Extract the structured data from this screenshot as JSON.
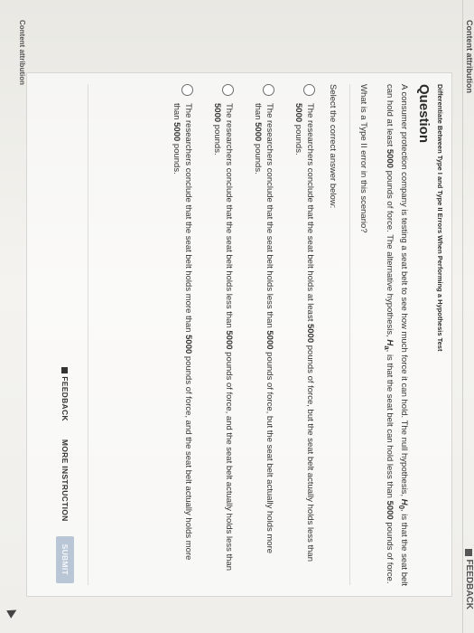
{
  "page": {
    "attribution_top": "Content attribution",
    "feedback_top": "FEEDBACK",
    "attribution_bottom": "Content attribution"
  },
  "question": {
    "breadcrumb": "Differentiate Between Type I and Type II Errors When Performing a Hypothesis Test",
    "heading": "Question",
    "text_part1": "A consumer protection company is testing a seat belt to see how much force it can hold. The null hypothesis, ",
    "h0": "H",
    "h0_sub": "0",
    "text_part2": ", is that the seat belt can hold at least ",
    "num1": "5000",
    "text_part3": " pounds of force. The alternative hypothesis, ",
    "ha": "H",
    "ha_sub": "a",
    "text_part4": ", is that the seat belt can hold less than ",
    "num2": "5000",
    "text_part5": " pounds of force.",
    "prompt": "What is a Type II error in this scenario?",
    "select_label": "Select the correct answer below:"
  },
  "answers": [
    {
      "pre": "The researchers conclude that the seat belt holds at least ",
      "n1": "5000",
      "mid": " pounds of force, but the seat belt actually holds less than ",
      "n2": "5000",
      "post": " pounds."
    },
    {
      "pre": "The researchers conclude that the seat belt holds less than ",
      "n1": "5000",
      "mid": " pounds of force, but the seat belt actually holds more than ",
      "n2": "5000",
      "post": " pounds."
    },
    {
      "pre": "The researchers conclude that the seat belt holds less than ",
      "n1": "5000",
      "mid": " pounds of force, and the seat belt actually holds less than ",
      "n2": "5000",
      "post": " pounds."
    },
    {
      "pre": "The researchers conclude that the seat belt holds more than ",
      "n1": "5000",
      "mid": " pounds of force, and the seat belt actually holds more than ",
      "n2": "5000",
      "post": " pounds."
    }
  ],
  "buttons": {
    "feedback": "FEEDBACK",
    "more_instruction": "MORE INSTRUCTION",
    "submit": "SUBMIT"
  },
  "icons": {
    "feedback_top": "flag-icon",
    "feedback_button": "flag-icon",
    "cursor": "mouse-cursor-icon"
  },
  "colors": {
    "submit_bg": "#b9c6d6",
    "text": "#333333"
  }
}
